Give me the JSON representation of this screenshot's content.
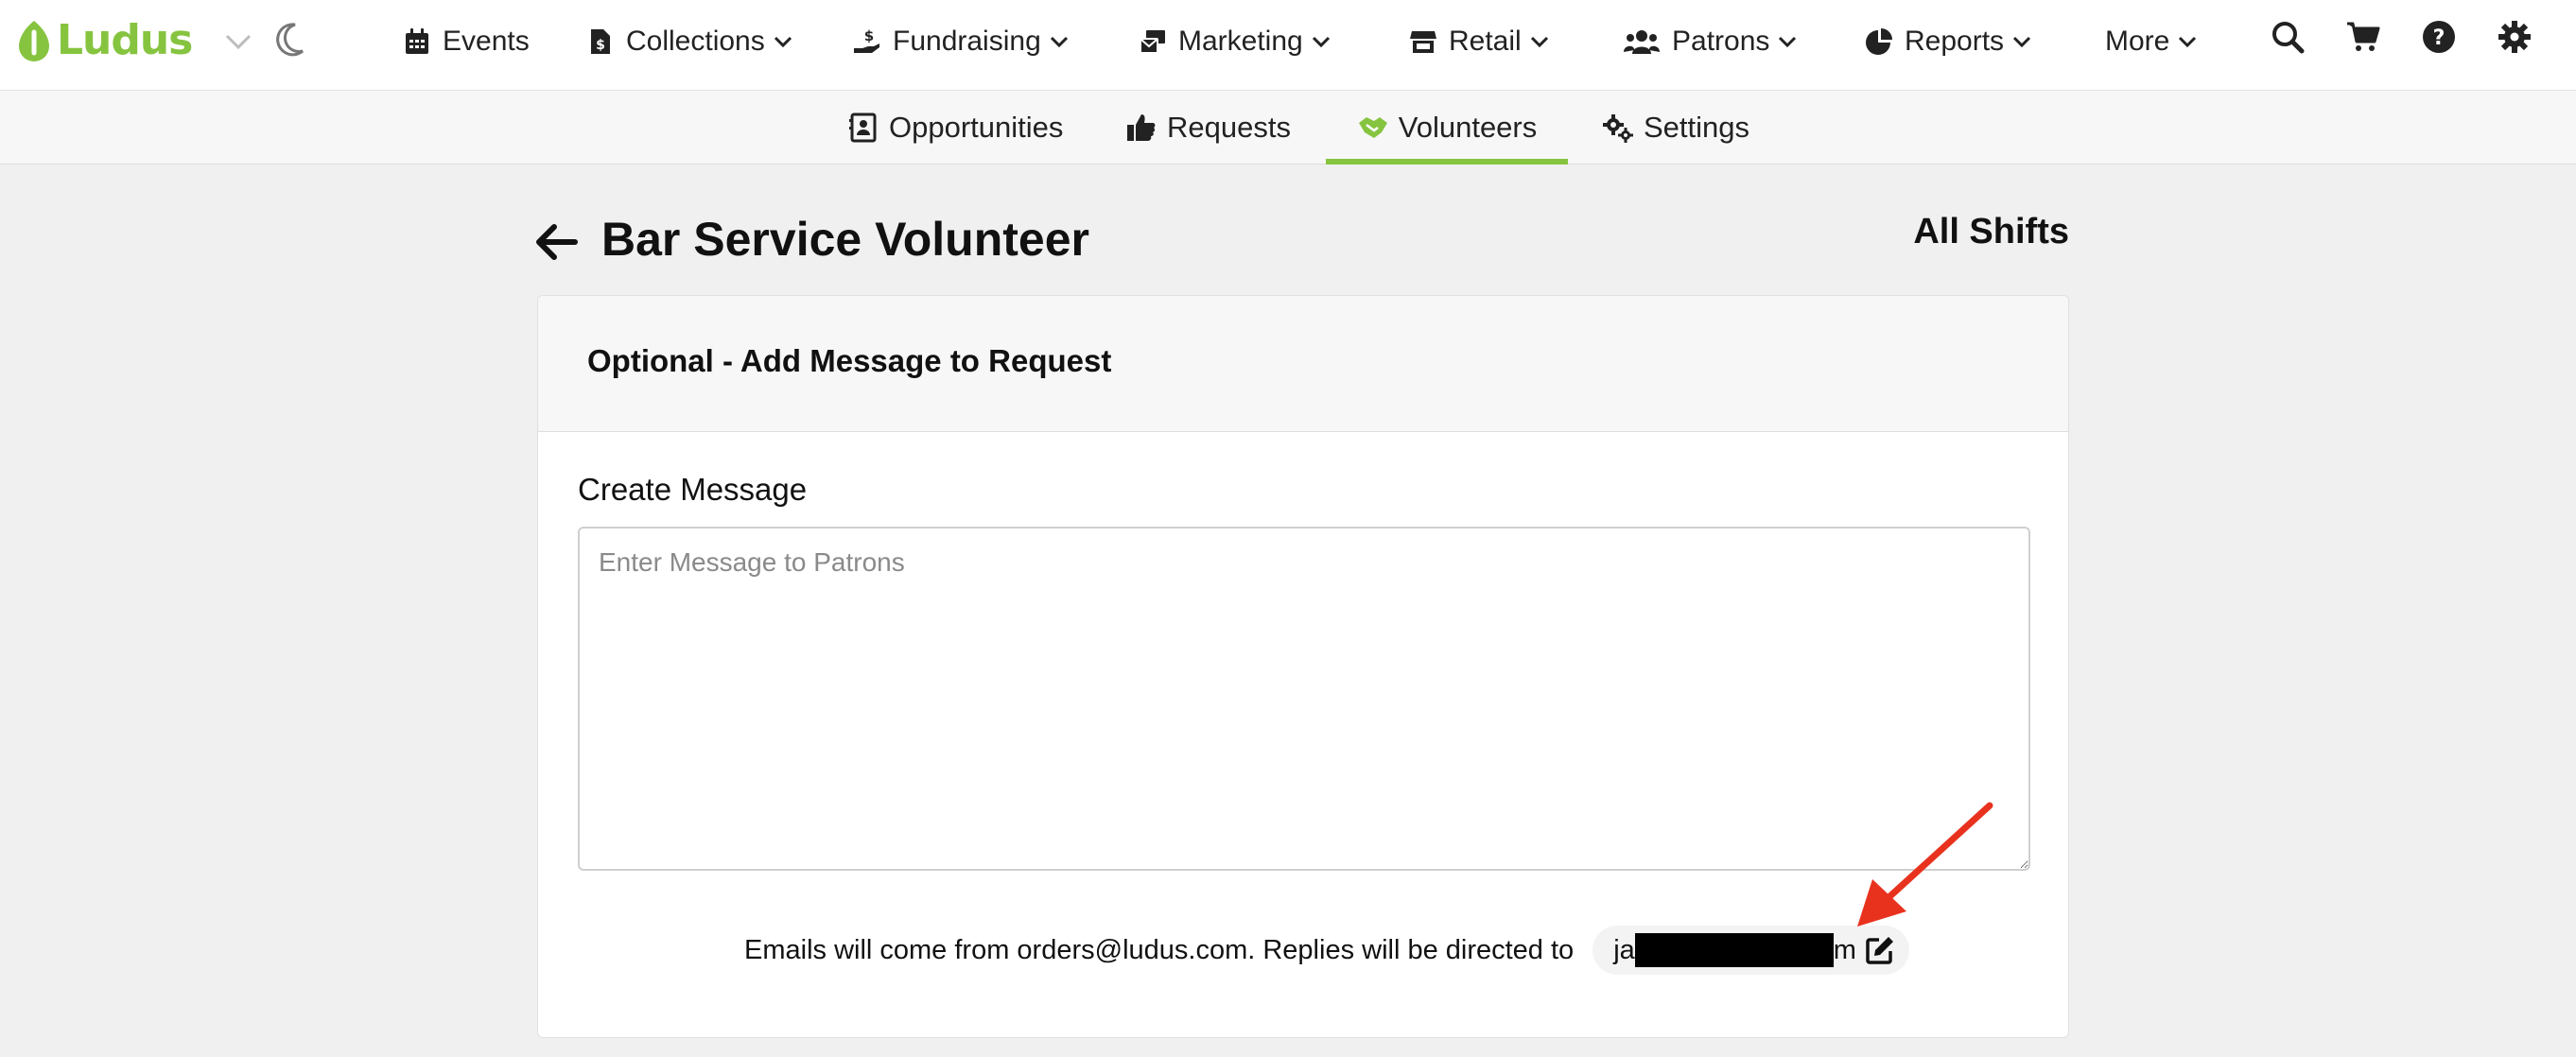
{
  "brand": {
    "name": "Ludus",
    "accent_color": "#86c440"
  },
  "topnav": {
    "items": [
      {
        "label": "Events",
        "icon": "calendar-icon",
        "has_dropdown": false
      },
      {
        "label": "Collections",
        "icon": "file-dollar-icon",
        "has_dropdown": true
      },
      {
        "label": "Fundraising",
        "icon": "hand-dollar-icon",
        "has_dropdown": true
      },
      {
        "label": "Marketing",
        "icon": "mail-bulk-icon",
        "has_dropdown": true
      },
      {
        "label": "Retail",
        "icon": "store-icon",
        "has_dropdown": true
      },
      {
        "label": "Patrons",
        "icon": "users-icon",
        "has_dropdown": true
      },
      {
        "label": "Reports",
        "icon": "pie-chart-icon",
        "has_dropdown": true
      },
      {
        "label": "More",
        "icon": "",
        "has_dropdown": true
      }
    ],
    "tools": [
      "search-icon",
      "cart-icon",
      "help-icon",
      "gear-icon"
    ]
  },
  "subnav": {
    "items": [
      {
        "label": "Opportunities",
        "icon": "contact-card-icon",
        "active": false
      },
      {
        "label": "Requests",
        "icon": "thumbs-up-icon",
        "active": false
      },
      {
        "label": "Volunteers",
        "icon": "handshake-icon",
        "active": true
      },
      {
        "label": "Settings",
        "icon": "gears-icon",
        "active": false
      }
    ]
  },
  "page": {
    "title": "Bar Service Volunteer",
    "all_shifts_link": "All Shifts"
  },
  "card": {
    "title": "Optional - Add Message to Request",
    "field_label": "Create Message",
    "message_placeholder": "Enter Message to Patrons",
    "message_value": "",
    "reply_notice": "Emails will come from orders@ludus.com. Replies will be directed to",
    "reply_email_visible_start": "ja",
    "reply_email_visible_end": "m"
  },
  "annotation": {
    "arrow_color": "#e8321e"
  }
}
